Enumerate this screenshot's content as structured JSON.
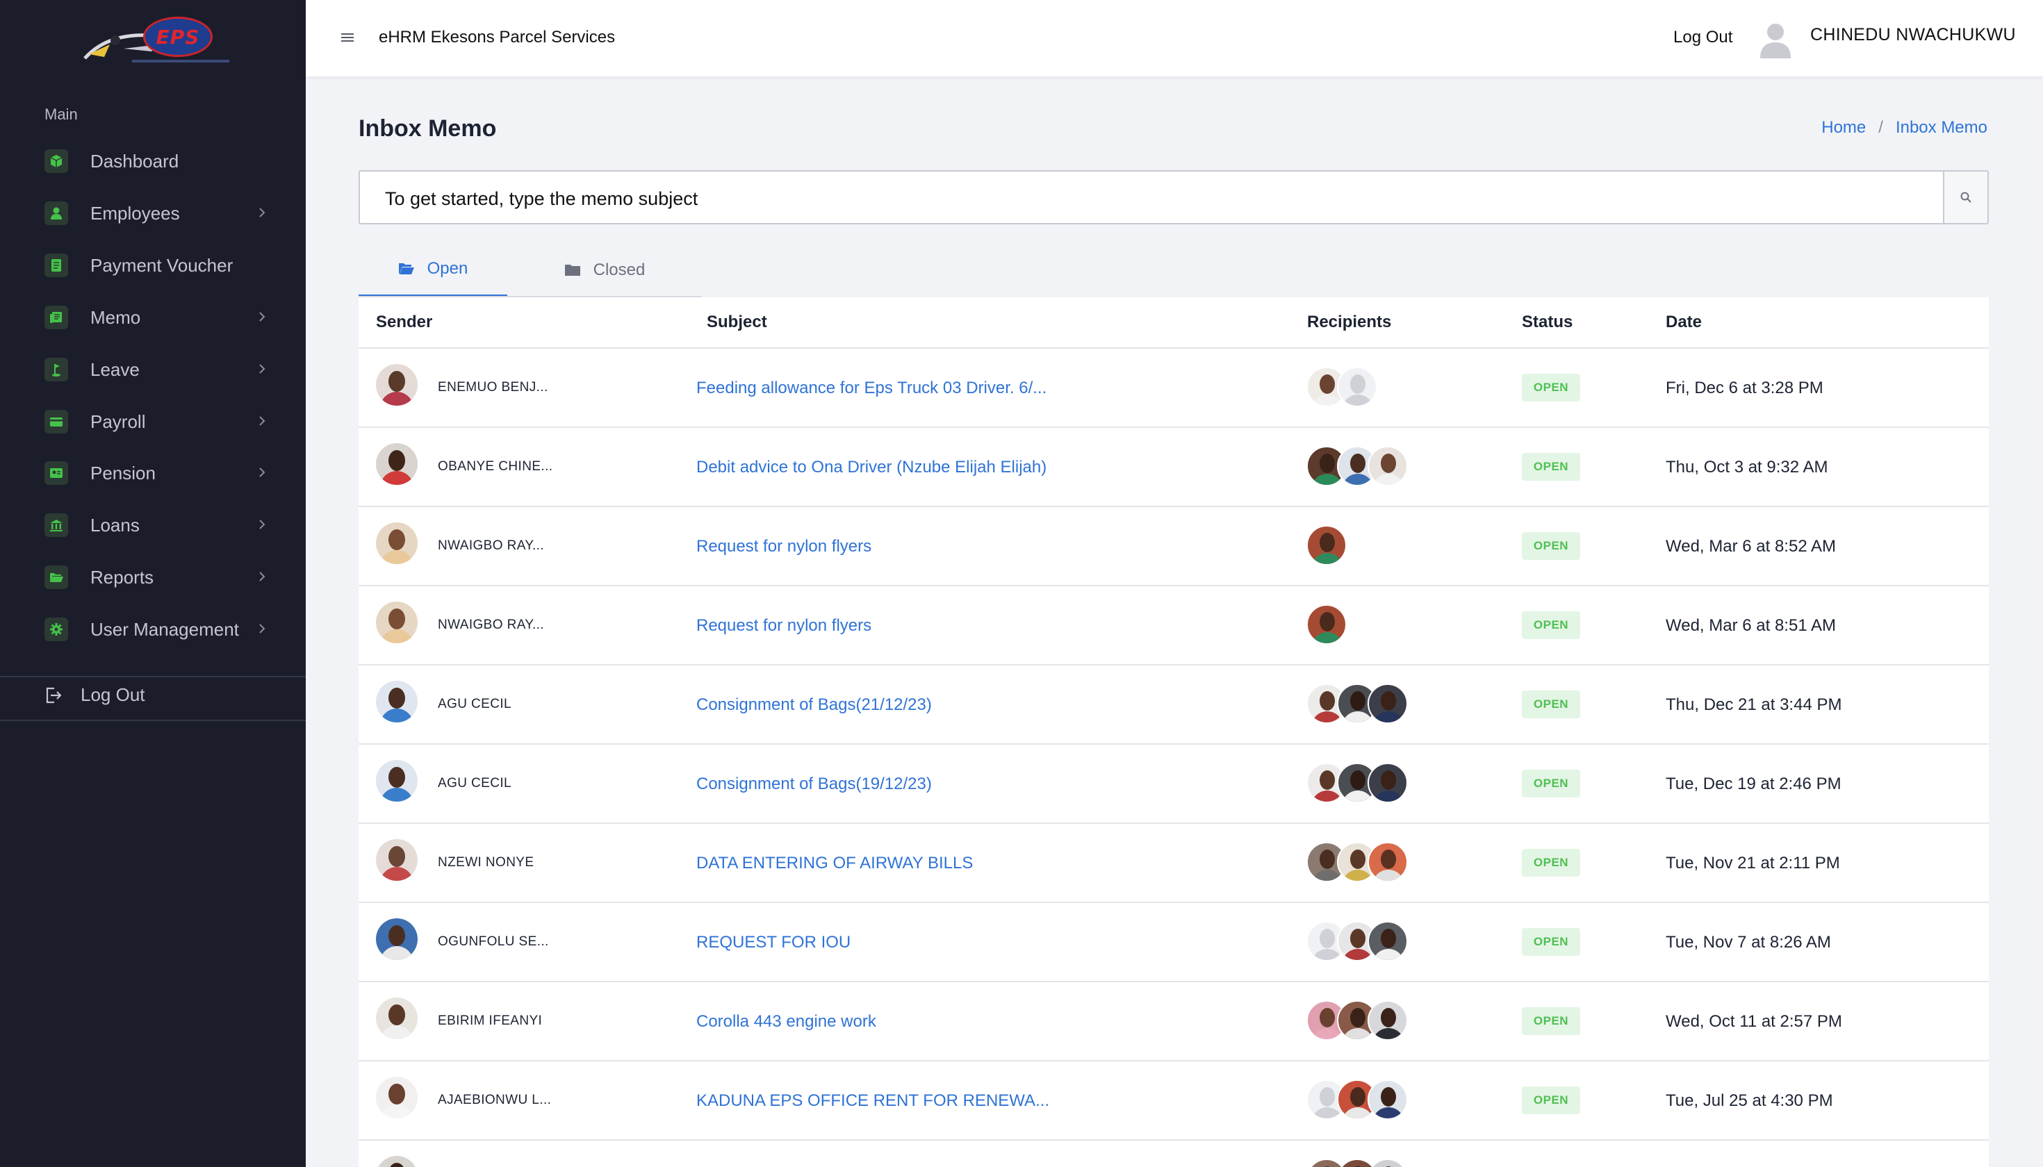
{
  "app": {
    "title": "eHRM Ekesons Parcel Services",
    "logo_text": "EPS",
    "logout_label": "Log Out",
    "user_name": "CHINEDU NWACHUKWU"
  },
  "sidebar": {
    "section_label": "Main",
    "items": [
      {
        "label": "Dashboard",
        "icon": "cube-icon",
        "has_submenu": false
      },
      {
        "label": "Employees",
        "icon": "person-icon",
        "has_submenu": true
      },
      {
        "label": "Payment Voucher",
        "icon": "document-icon",
        "has_submenu": false
      },
      {
        "label": "Memo",
        "icon": "newspaper-icon",
        "has_submenu": true
      },
      {
        "label": "Leave",
        "icon": "golf-flag-icon",
        "has_submenu": true
      },
      {
        "label": "Payroll",
        "icon": "card-icon",
        "has_submenu": true
      },
      {
        "label": "Pension",
        "icon": "id-card-icon",
        "has_submenu": true
      },
      {
        "label": "Loans",
        "icon": "bank-icon",
        "has_submenu": true
      },
      {
        "label": "Reports",
        "icon": "folder-open-icon",
        "has_submenu": true
      },
      {
        "label": "User Management",
        "icon": "gear-icon",
        "has_submenu": true
      }
    ],
    "logout_label": "Log Out"
  },
  "page": {
    "title": "Inbox Memo",
    "breadcrumb": [
      "Home",
      "Inbox Memo"
    ]
  },
  "search": {
    "value": "To get started, type the memo subject"
  },
  "tabs": [
    {
      "label": "Open",
      "active": true
    },
    {
      "label": "Closed",
      "active": false
    }
  ],
  "table": {
    "columns": [
      "Sender",
      "Subject",
      "Recipients",
      "Status",
      "Date"
    ],
    "rows": [
      {
        "sender": "ENEMUO BENJ...",
        "subject": "Feeding allowance for Eps Truck 03 Driver. 6/...",
        "recipients": 2,
        "status": "OPEN",
        "date": "Fri, Dec 6 at 3:28 PM"
      },
      {
        "sender": "OBANYE CHINE...",
        "subject": "Debit advice to Ona Driver (Nzube Elijah Elijah)",
        "recipients": 3,
        "status": "OPEN",
        "date": "Thu, Oct 3 at 9:32 AM"
      },
      {
        "sender": "NWAIGBO RAY...",
        "subject": "Request for nylon flyers",
        "recipients": 1,
        "status": "OPEN",
        "date": "Wed, Mar 6 at 8:52 AM"
      },
      {
        "sender": "NWAIGBO RAY...",
        "subject": "Request for nylon flyers",
        "recipients": 1,
        "status": "OPEN",
        "date": "Wed, Mar 6 at 8:51 AM"
      },
      {
        "sender": "AGU CECIL",
        "subject": "Consignment of Bags(21/12/23)",
        "recipients": 3,
        "status": "OPEN",
        "date": "Thu, Dec 21 at 3:44 PM"
      },
      {
        "sender": "AGU CECIL",
        "subject": "Consignment of Bags(19/12/23)",
        "recipients": 3,
        "status": "OPEN",
        "date": "Tue, Dec 19 at 2:46 PM"
      },
      {
        "sender": "NZEWI NONYE",
        "subject": "DATA ENTERING OF AIRWAY BILLS",
        "recipients": 3,
        "status": "OPEN",
        "date": "Tue, Nov 21 at 2:11 PM"
      },
      {
        "sender": "OGUNFOLU SE...",
        "subject": "REQUEST FOR IOU",
        "recipients": 3,
        "status": "OPEN",
        "date": "Tue, Nov 7 at 8:26 AM"
      },
      {
        "sender": "EBIRIM IFEANYI",
        "subject": "Corolla 443 engine work",
        "recipients": 3,
        "status": "OPEN",
        "date": "Wed, Oct 11 at 2:57 PM"
      },
      {
        "sender": "AJAEBIONWU L...",
        "subject": "KADUNA EPS OFFICE RENT FOR RENEWA...",
        "recipients": 3,
        "status": "OPEN",
        "date": "Tue, Jul 25 at 4:30 PM"
      }
    ]
  },
  "colors": {
    "sidebar_bg": "#1c1d2b",
    "icon_green": "#45c24a",
    "link_blue": "#2f73d6",
    "badge_bg": "#e3f5e4",
    "badge_text": "#4fbf53"
  }
}
